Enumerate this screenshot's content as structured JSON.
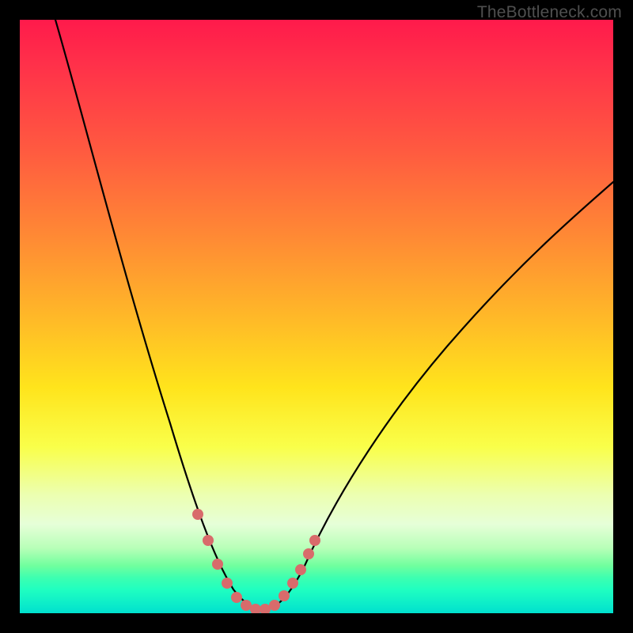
{
  "watermark": "TheBottleneck.com",
  "chart_data": {
    "type": "line",
    "title": "",
    "xlabel": "",
    "ylabel": "",
    "xlim": [
      0,
      100
    ],
    "ylim": [
      0,
      100
    ],
    "series": [
      {
        "name": "bottleneck-curve",
        "x": [
          5,
          10,
          15,
          20,
          25,
          28,
          30,
          32,
          34,
          36,
          38,
          40,
          42,
          45,
          50,
          55,
          60,
          65,
          70,
          75,
          80,
          85,
          90,
          95,
          100
        ],
        "values": [
          100,
          88,
          75,
          62,
          47,
          34,
          24,
          15,
          8,
          4,
          2,
          2,
          4,
          8,
          16,
          23,
          30,
          36,
          42,
          48,
          53,
          58,
          62,
          66,
          70
        ]
      }
    ],
    "highlight_points": {
      "name": "trough-dots",
      "x": [
        28,
        30,
        32,
        34,
        36,
        38,
        40,
        42,
        44,
        45,
        46
      ],
      "values": [
        34,
        24,
        15,
        8,
        4,
        2,
        2,
        4,
        8,
        12,
        16
      ]
    },
    "gradient_stops": [
      {
        "pos": 0.0,
        "color": "#ff1a4b"
      },
      {
        "pos": 0.22,
        "color": "#ff5a40"
      },
      {
        "pos": 0.5,
        "color": "#ffb828"
      },
      {
        "pos": 0.72,
        "color": "#f9ff4a"
      },
      {
        "pos": 0.89,
        "color": "#b8ffb8"
      },
      {
        "pos": 1.0,
        "color": "#00e0ce"
      }
    ]
  }
}
